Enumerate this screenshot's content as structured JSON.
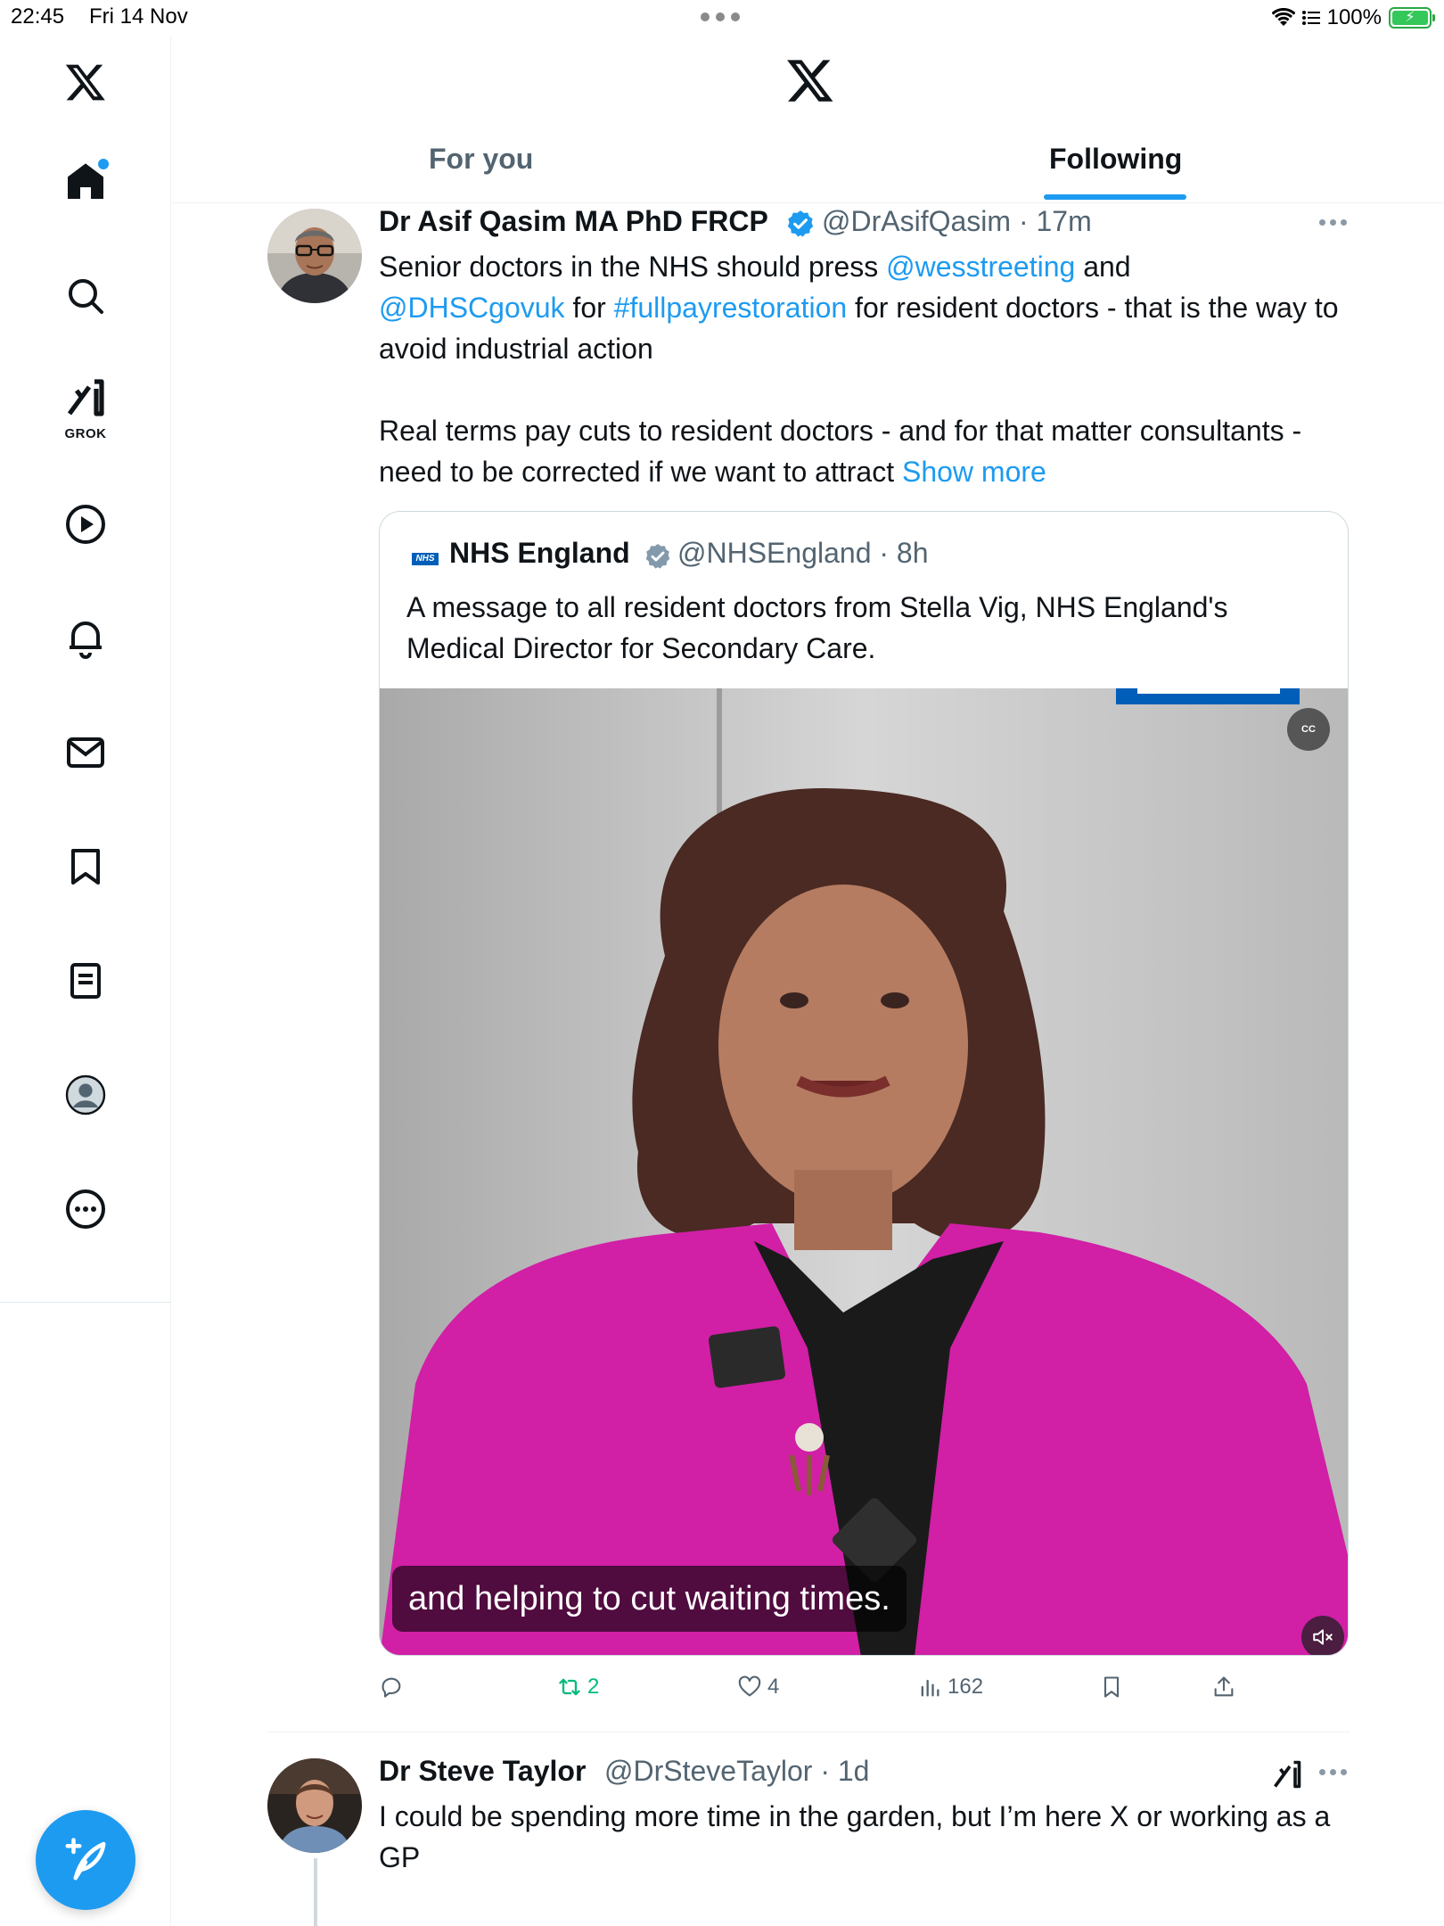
{
  "status_bar": {
    "time": "22:45",
    "date": "Fri 14 Nov",
    "battery": "100%",
    "icons": [
      "wifi-icon",
      "signal-icon",
      "battery-charging-icon"
    ]
  },
  "app": {
    "logo_icon": "x-logo-icon",
    "accent_color": "#1d9bf0"
  },
  "sidebar": {
    "items": [
      {
        "name": "x-logo",
        "icon": "x-logo-icon"
      },
      {
        "name": "home",
        "icon": "home-icon",
        "active": true
      },
      {
        "name": "search",
        "icon": "search-icon"
      },
      {
        "name": "grok",
        "icon": "grok-icon",
        "label": "GROK"
      },
      {
        "name": "video",
        "icon": "play-icon"
      },
      {
        "name": "notifications",
        "icon": "bell-icon"
      },
      {
        "name": "messages",
        "icon": "mail-icon"
      },
      {
        "name": "bookmarks",
        "icon": "bookmark-icon"
      },
      {
        "name": "articles",
        "icon": "document-icon"
      },
      {
        "name": "profile",
        "icon": "profile-icon"
      },
      {
        "name": "more",
        "icon": "more-circle-icon"
      }
    ],
    "compose_icon": "compose-post-icon"
  },
  "header": {
    "tabs": [
      {
        "label": "For you",
        "selected": false
      },
      {
        "label": "Following",
        "selected": true
      }
    ]
  },
  "tweets": [
    {
      "author_name": "Dr Asif Qasim MA PhD FRCP",
      "handle": "@DrAsifQasim",
      "separator": "·",
      "time": "17m",
      "verified": true,
      "text": {
        "p1_a": "Senior doctors in the NHS should press ",
        "mention_1": "@wesstreeting",
        "p1_b": " and",
        "mention_2": "@DHSCgovuk",
        "p1_c": " for ",
        "hashtag": "#fullpayrestoration",
        "p1_d": " for resident doctors - that is the way to avoid industrial action",
        "p2_a": "Real terms pay cuts to resident doctors - and for that matter consultants - need to be corrected if we want to attract ",
        "show_more": "Show more"
      },
      "quote": {
        "logo_text": "NHS",
        "author_name": "NHS England",
        "handle": "@NHSEngland",
        "separator": "·",
        "time": "8h",
        "verified": true,
        "text": "A message to all resident doctors from Stella Vig, NHS England's Medical Director for Secondary Care.",
        "video": {
          "caption": "and helping to cut waiting times.",
          "cc_label": "CC",
          "muted": true
        }
      },
      "actions": {
        "reply_count": "",
        "retweet_count": "2",
        "like_count": "4",
        "views_count": "162",
        "retweeted": true
      }
    },
    {
      "author_name": "Dr Steve Taylor",
      "handle": "@DrSteveTaylor",
      "separator": "·",
      "time": "1d",
      "verified": false,
      "text": "I could be spending more time in the garden, but I’m here X or working as a GP"
    }
  ]
}
